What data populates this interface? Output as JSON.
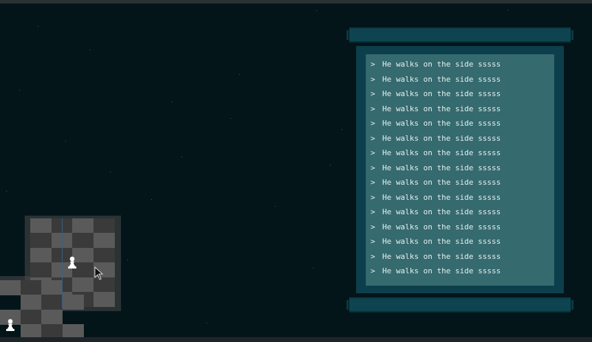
{
  "log": {
    "entries": [
      "He walks on the side sssss",
      "He walks on the side sssss",
      "He walks on the side sssss",
      "He walks on the side sssss",
      "He walks on the side sssss",
      "He walks on the side sssss",
      "He walks on the side sssss",
      "He walks on the side sssss",
      "He walks on the side sssss",
      "He walks on the side sssss",
      "He walks on the side sssss",
      "He walks on the side sssss",
      "He walks on the side sssss",
      "He walks on the side sssss",
      "He walks on the side sssss"
    ],
    "bullet": ">"
  },
  "pieces": [
    {
      "name": "white-pawn-1",
      "glyph": "♟",
      "color": "#ffffff"
    },
    {
      "name": "white-pawn-2",
      "glyph": "♟",
      "color": "#ffffff"
    }
  ],
  "colors": {
    "background": "#04151a",
    "light_square": "#5a5a5a",
    "dark_square": "#3a3a3a",
    "scroll_frame": "#0c3f4b",
    "scroll_paper": "#356a6f"
  }
}
